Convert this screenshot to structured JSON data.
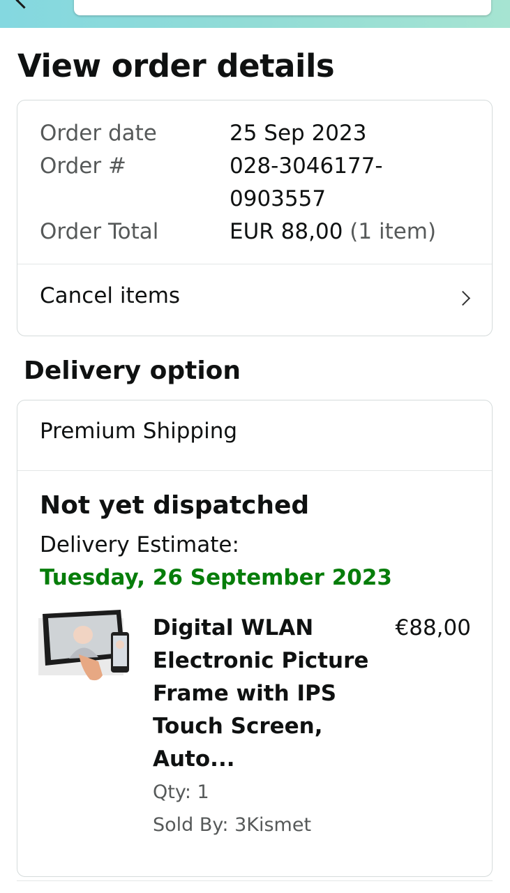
{
  "header": {
    "search_icon": "search-icon",
    "camera_icon": "camera-icon",
    "back_icon": "back-arrow-icon"
  },
  "page": {
    "title": "View order details"
  },
  "summary": {
    "order_date_label": "Order date",
    "order_date_value": "25 Sep 2023",
    "order_number_label": "Order #",
    "order_number_line1": "028-3046177-",
    "order_number_line2": "0903557",
    "order_total_label": "Order Total",
    "order_total_value": "EUR 88,00",
    "order_total_items": "(1 item)",
    "cancel_label": "Cancel items"
  },
  "delivery": {
    "heading": "Delivery option",
    "shipping_method": "Premium Shipping",
    "status": "Not yet dispatched",
    "estimate_label": "Delivery Estimate:",
    "estimate_date": "Tuesday, 26 September 2023"
  },
  "item": {
    "title": "Digital WLAN Electronic Picture Frame with IPS Touch Screen, Auto...",
    "price": "€88,00",
    "qty": "Qty: 1",
    "seller": "Sold By: 3Kismet"
  },
  "colors": {
    "accent_green": "#067d0a",
    "header_gradient_start": "#84d8e0",
    "header_gradient_end": "#a6e4d2",
    "border": "#d5dbdb",
    "muted_text": "#565959"
  }
}
